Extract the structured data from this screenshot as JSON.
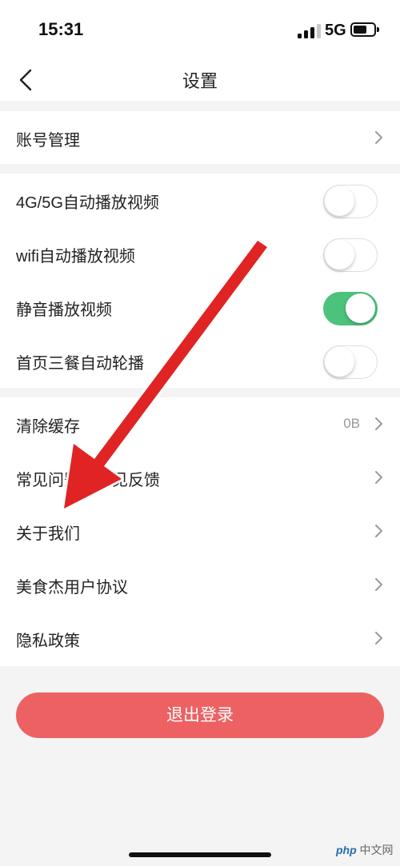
{
  "status_bar": {
    "time": "15:31",
    "network": "5G"
  },
  "nav": {
    "title": "设置"
  },
  "account": {
    "label": "账号管理"
  },
  "toggles": [
    {
      "label": "4G/5G自动播放视频",
      "on": false
    },
    {
      "label": "wifi自动播放视频",
      "on": false
    },
    {
      "label": "静音播放视频",
      "on": true
    },
    {
      "label": "首页三餐自动轮播",
      "on": false
    }
  ],
  "items": [
    {
      "label": "清除缓存",
      "value": "0B"
    },
    {
      "label": "常见问题及意见反馈"
    },
    {
      "label": "关于我们"
    },
    {
      "label": "美食杰用户协议"
    },
    {
      "label": "隐私政策"
    }
  ],
  "logout": {
    "label": "退出登录"
  },
  "watermark": {
    "text": "中文网",
    "brand": "php"
  },
  "colors": {
    "switch_on": "#4bc37c",
    "logout_bg": "#ed6163",
    "annotation_arrow": "#e02424"
  }
}
